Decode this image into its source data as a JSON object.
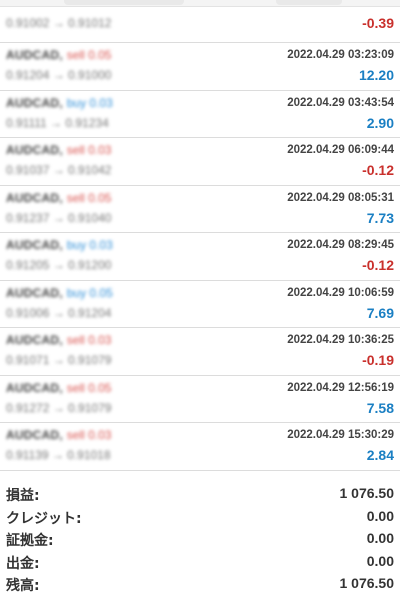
{
  "trades": [
    {
      "symbol": "",
      "type": "",
      "type_class": "",
      "timestamp": "",
      "prices": "0.91002 → 0.91012",
      "profit": "-0.39",
      "sign": "neg",
      "partial": true
    },
    {
      "symbol": "AUDCAD,",
      "type": "sell 0.05",
      "type_class": "sell",
      "timestamp": "2022.04.29 03:23:09",
      "prices": "0.91204 → 0.91000",
      "profit": "12.20",
      "sign": "pos",
      "partial": false
    },
    {
      "symbol": "AUDCAD,",
      "type": "buy 0.03",
      "type_class": "buy",
      "timestamp": "2022.04.29 03:43:54",
      "prices": "0.91111 → 0.91234",
      "profit": "2.90",
      "sign": "pos",
      "partial": false
    },
    {
      "symbol": "AUDCAD,",
      "type": "sell 0.03",
      "type_class": "sell",
      "timestamp": "2022.04.29 06:09:44",
      "prices": "0.91037 → 0.91042",
      "profit": "-0.12",
      "sign": "neg",
      "partial": false
    },
    {
      "symbol": "AUDCAD,",
      "type": "sell 0.05",
      "type_class": "sell",
      "timestamp": "2022.04.29 08:05:31",
      "prices": "0.91237 → 0.91040",
      "profit": "7.73",
      "sign": "pos",
      "partial": false
    },
    {
      "symbol": "AUDCAD,",
      "type": "buy 0.03",
      "type_class": "buy",
      "timestamp": "2022.04.29 08:29:45",
      "prices": "0.91205 → 0.91200",
      "profit": "-0.12",
      "sign": "neg",
      "partial": false
    },
    {
      "symbol": "AUDCAD,",
      "type": "buy 0.05",
      "type_class": "buy",
      "timestamp": "2022.04.29 10:06:59",
      "prices": "0.91006 → 0.91204",
      "profit": "7.69",
      "sign": "pos",
      "partial": false
    },
    {
      "symbol": "AUDCAD,",
      "type": "sell 0.03",
      "type_class": "sell",
      "timestamp": "2022.04.29 10:36:25",
      "prices": "0.91071 → 0.91079",
      "profit": "-0.19",
      "sign": "neg",
      "partial": false
    },
    {
      "symbol": "AUDCAD,",
      "type": "sell 0.05",
      "type_class": "sell",
      "timestamp": "2022.04.29 12:56:19",
      "prices": "0.91272 → 0.91079",
      "profit": "7.58",
      "sign": "pos",
      "partial": false
    },
    {
      "symbol": "AUDCAD,",
      "type": "sell 0.03",
      "type_class": "sell",
      "timestamp": "2022.04.29 15:30:29",
      "prices": "0.91139 → 0.91018",
      "profit": "2.84",
      "sign": "pos",
      "partial": false
    }
  ],
  "summary": [
    {
      "label": "損益:",
      "value": "1 076.50"
    },
    {
      "label": "クレジット:",
      "value": "0.00"
    },
    {
      "label": "証拠金:",
      "value": "0.00"
    },
    {
      "label": "出金:",
      "value": "0.00"
    },
    {
      "label": "残高:",
      "value": "1 076.50"
    }
  ],
  "colors": {
    "profit_positive": "#1a7fc3",
    "profit_negative": "#c9302c",
    "sell": "#d9534f",
    "buy": "#2f8fd8"
  }
}
